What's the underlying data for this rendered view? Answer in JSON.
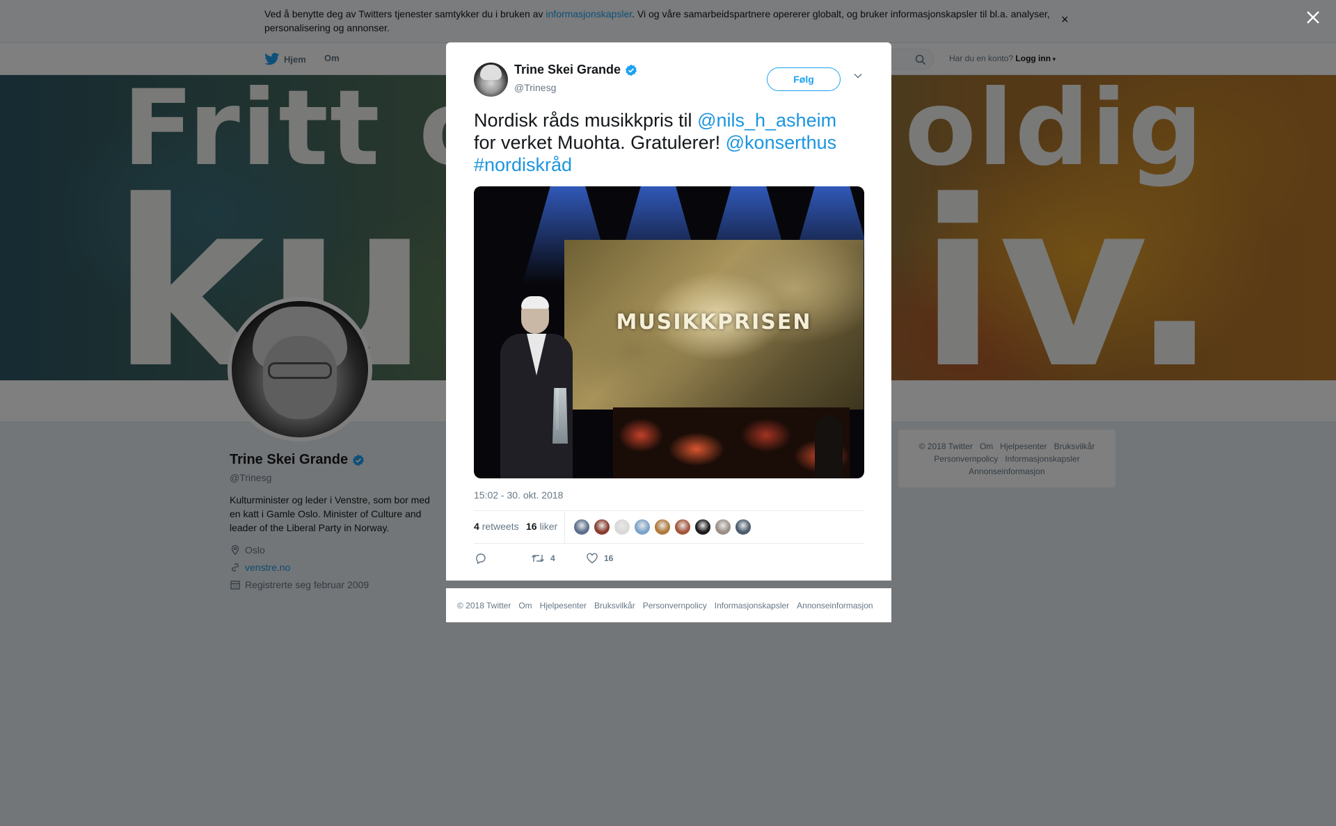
{
  "cookie_banner": {
    "text_before": "Ved å benytte deg av Twitters tjenester samtykker du i bruken av ",
    "link": "informasjonskapsler",
    "text_after": ". Vi og våre samarbeidspartnere opererer globalt, og bruker informasjonskapsler til bl.a. analyser, personalisering og annonser.",
    "close": "×"
  },
  "nav": {
    "home": "Hjem",
    "about": "Om",
    "account_prompt": "Har du en konto?",
    "login": "Logg inn"
  },
  "banner": {
    "line1_left": "Fritt o",
    "line1_right": "oldig",
    "line2_left": "ku",
    "line2_right": "iv."
  },
  "profile": {
    "name": "Trine Skei Grande",
    "handle": "@Trinesg",
    "bio": "Kulturminister og leder i Venstre, som bor med en katt i Gamle Oslo. Minister of Culture and leader of the Liberal Party in Norway.",
    "location": "Oslo",
    "website": "venstre.no",
    "joined": "Registrerte seg februar 2009"
  },
  "sidebar_footer": {
    "items": [
      "© 2018 Twitter",
      "Om",
      "Hjelpesenter",
      "Bruksvilkår",
      "Personvernpolicy",
      "Informasjonskapsler",
      "Annonseinformasjon"
    ]
  },
  "tweet": {
    "author_name": "Trine Skei Grande",
    "author_handle": "@Trinesg",
    "follow_label": "Følg",
    "text_part1": "Nordisk råds musikkpris til ",
    "mention1": "@nils_h_asheim",
    "text_part2": " for verket Muohta. Gratulerer! ",
    "mention2": "@konserthus",
    "hashtag": "#nordiskråd",
    "media_caption": "MUSIKKPRISEN",
    "timestamp": "15:02 - 30. okt. 2018",
    "retweets_count": "4",
    "retweets_label": "retweets",
    "likes_count": "16",
    "likes_label": "liker",
    "reply_count": "",
    "action_retweets": "4",
    "action_likes": "16",
    "liker_colors": [
      "#5b6f8c",
      "#8a3b2e",
      "#d9d9d9",
      "#7ba3c9",
      "#b07a3c",
      "#a4553c",
      "#1c1c1c",
      "#9a8f86",
      "#4c5b6e"
    ]
  },
  "modal_footer": {
    "items": [
      "© 2018 Twitter",
      "Om",
      "Hjelpesenter",
      "Bruksvilkår",
      "Personvernpolicy",
      "Informasjonskapsler",
      "Annonseinformasjon"
    ]
  },
  "colors": {
    "twitter_blue": "#1da1f2",
    "link_blue": "#1b95e0",
    "verified": "#1da1f2",
    "overlay": "rgba(0,0,0,0.5)"
  },
  "icons": {
    "nav_home": "twitter-bird-icon",
    "search": "search-icon",
    "verified": "verified-badge-icon",
    "caret": "chevron-down-icon",
    "reply": "reply-icon",
    "retweet": "retweet-icon",
    "like": "heart-icon",
    "close": "close-icon",
    "location": "location-pin-icon",
    "link": "link-icon",
    "calendar": "calendar-icon"
  }
}
